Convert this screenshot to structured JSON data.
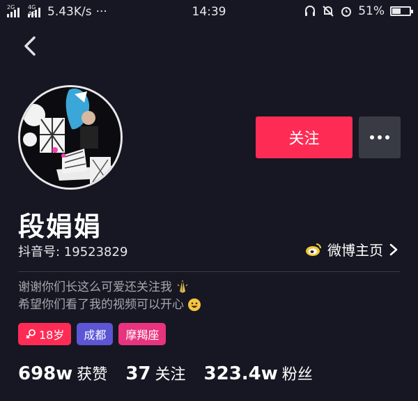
{
  "status_bar": {
    "network_tag_1": "2G",
    "network_tag_2": "4G 4G",
    "speed": "5.43K/s",
    "more": "···",
    "time": "14:39",
    "battery_percent": "51%",
    "battery_level": 0.51
  },
  "nav": {
    "back_icon": "chevron-left-icon"
  },
  "profile": {
    "name": "段娟娟",
    "douyin_id": "抖音号: 19523829",
    "weibo_link": "微博主页",
    "bio_line_1": "谢谢你们长这么可爱还关注我",
    "bio_line_2": "希望你们看了我的视频可以开心"
  },
  "actions": {
    "follow_label": "关注",
    "more_icon": "ellipsis-icon"
  },
  "tags": [
    {
      "label": "18岁",
      "color": "#fe2c55",
      "icon": "female-icon"
    },
    {
      "label": "成都",
      "color": "#5c55d6"
    },
    {
      "label": "摩羯座",
      "color": "#e8337e"
    }
  ],
  "stats": [
    {
      "value": "698w",
      "label": "获赞"
    },
    {
      "value": "37",
      "label": "关注"
    },
    {
      "value": "323.4w",
      "label": "粉丝"
    }
  ],
  "colors": {
    "background": "#161722",
    "accent": "#fe2c55"
  }
}
